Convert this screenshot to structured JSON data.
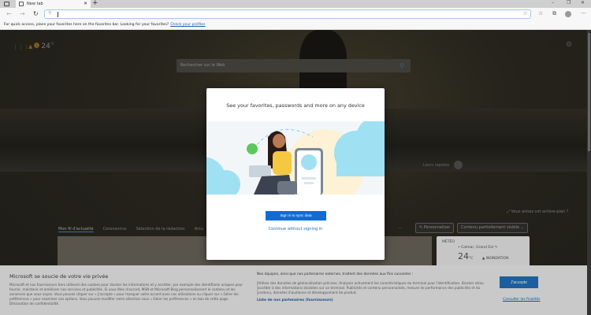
{
  "browser": {
    "tab_title": "New tab",
    "address_value": "",
    "favorites_message": "For quick access, place your favorites here on the favorites bar. Looking for your favorites?",
    "favorites_link": "Check your profiles"
  },
  "newtab": {
    "temperature": "24",
    "temp_unit": "°C",
    "search_placeholder": "Rechercher sur le Web",
    "quick_links": "Liens rapides",
    "background_prompt": "Vous aimez cet arrière-plan ?",
    "feed_tabs": [
      "Mon fil d'actualité",
      "Coronavirus",
      "Sélection de la rédaction",
      "Actu"
    ],
    "more": "...",
    "personalize": "Personnaliser",
    "content_visibility": "Contenu partiellement visible",
    "weather_card": {
      "title": "MÉTÉO",
      "location": "Colmar, Grand Est",
      "temp": "24",
      "unit": "°C",
      "alert": "INONDATION"
    }
  },
  "dialog": {
    "title": "See your favorites, passwords and more on any device",
    "sign_in": "Sign in to sync data",
    "continue": "Continue without signing in"
  },
  "cookie": {
    "title": "Microsoft se soucie de votre vie privée",
    "body": "Microsoft et nos fournisseurs tiers utilisent des cookies pour stocker les informations et y accéder, par exemple des identifiants uniques pour fournir, maintenir et améliorer nos services et publicités. Si vous êtes d'accord, MSN et Microsoft Bing personnaliseront le contenu et les annonces que vous voyez. Vous pouvez cliquer sur « J'accepte » pour marquer votre accord avec ces utilisations ou cliquer sur « Gérer les préférences » pour examiner vos options. Vous pouvez modifier votre sélection sous « Gérer les préférences » en bas de cette page. Déclaration de confidentialité.",
    "partners_heading": "Nos équipes, ainsi que nos partenaires externes, traitent des données aux fins suivantes :",
    "partners_body": "Utiliser des données de géolocalisation précises. Analyser activement les caractéristiques du terminal pour l'identification. Stocker et/ou accéder à des informations stockées sur un terminal. Publicités et contenu personnalisés, mesure de performance des publicités et du contenu, données d'audience et développement de produit.",
    "partners_link": "Liste de nos partenaires (fournisseurs)",
    "accept": "J'accepte",
    "consult": "Consulter les finalités"
  },
  "colors": {
    "accent": "#0f6cd6",
    "link": "#1a6fc9"
  }
}
